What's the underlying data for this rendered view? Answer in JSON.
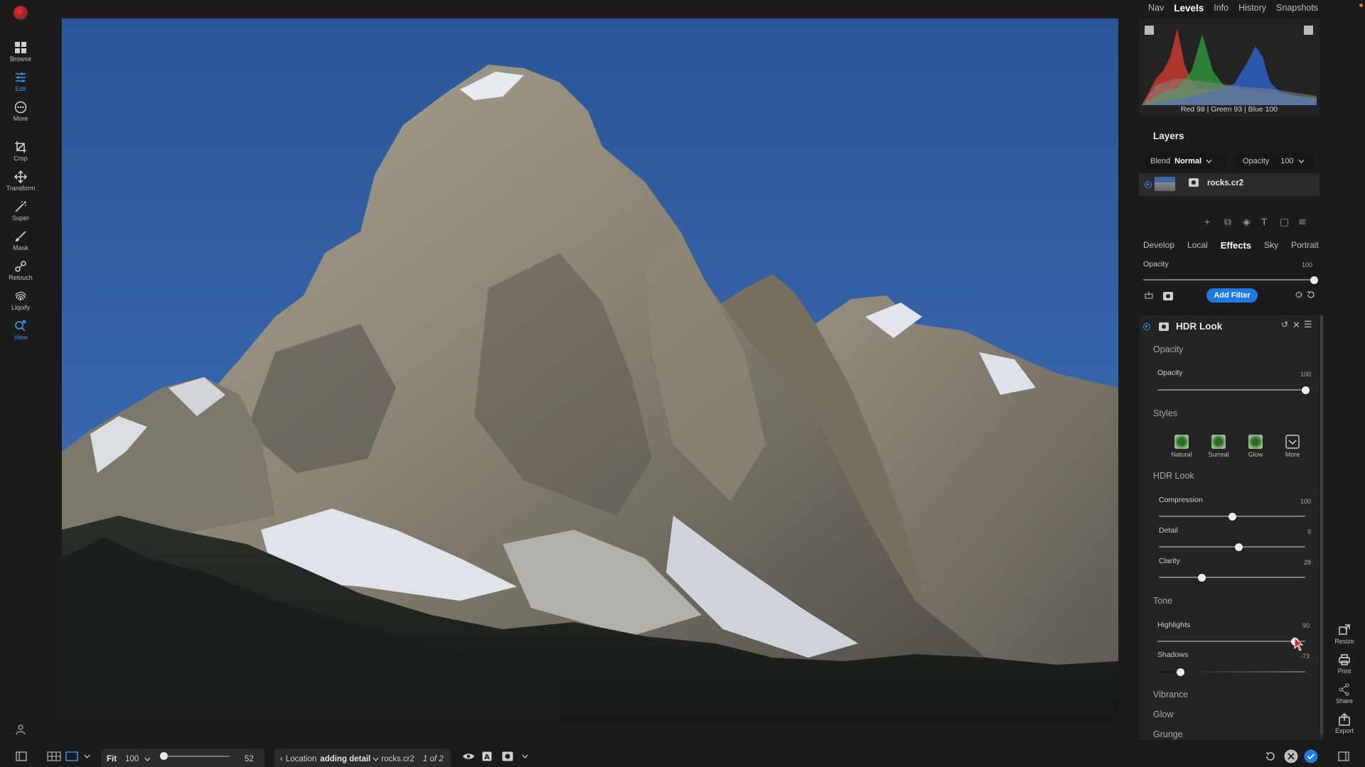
{
  "left_toolbar": {
    "tools": [
      {
        "label": "Browse",
        "icon": "grid-icon"
      },
      {
        "label": "Edit",
        "icon": "sliders-icon",
        "active": true
      },
      {
        "label": "More",
        "icon": "more-circle-icon"
      },
      {
        "label": "Crop",
        "icon": "crop-icon"
      },
      {
        "label": "Transform",
        "icon": "move-icon"
      },
      {
        "label": "Super",
        "icon": "wand-icon"
      },
      {
        "label": "Mask",
        "icon": "brush-icon"
      },
      {
        "label": "Retouch",
        "icon": "retouch-icon"
      },
      {
        "label": "Liquify",
        "icon": "fingerprint-icon"
      },
      {
        "label": "View",
        "icon": "view-icon"
      }
    ]
  },
  "panel_tabs": [
    "Nav",
    "Levels",
    "Info",
    "History",
    "Snapshots"
  ],
  "panel_tab_active": "Levels",
  "histogram": {
    "readout": {
      "red_label": "Red",
      "red": "98",
      "green_label": "| Green",
      "green": "93",
      "blue_label": "| Blue",
      "blue": "100"
    }
  },
  "layers": {
    "title": "Layers",
    "blend_label": "Blend",
    "blend_value": "Normal",
    "opacity_label": "Opacity",
    "opacity_value": "100",
    "items": [
      {
        "name": "rocks.cr2",
        "visible": true
      }
    ]
  },
  "module_tabs": [
    "Develop",
    "Local",
    "Effects",
    "Sky",
    "Portrait"
  ],
  "module_tab_active": "Effects",
  "effects": {
    "opacity_label": "Opacity",
    "opacity_value": "100",
    "opacity_fraction": 1.0,
    "add_filter_label": "Add Filter"
  },
  "filter": {
    "name": "HDR Look",
    "opacity_group": "Opacity",
    "opacity_label": "Opacity",
    "opacity_value": "100",
    "opacity_fraction": 1.0,
    "styles_group": "Styles",
    "styles": [
      "Natural",
      "Surreal",
      "Glow",
      "More"
    ],
    "hdr_group": "HDR Look",
    "compression_label": "Compression",
    "compression_value": "100",
    "compression_fraction": 0.5,
    "detail_label": "Detail",
    "detail_value": "9",
    "detail_fraction": 0.545,
    "clarity_label": "Clarity",
    "clarity_value": "28",
    "clarity_fraction": 0.29,
    "tone_group": "Tone",
    "highlights_label": "Highlights",
    "highlights_value": "90",
    "highlights_fraction": 0.93,
    "shadows_label": "Shadows",
    "shadows_value": "-73",
    "shadows_fraction": 0.155,
    "collapsed_groups": [
      "Vibrance",
      "Glow",
      "Grunge"
    ]
  },
  "right_strip": [
    "Resize",
    "Print",
    "Share",
    "Export"
  ],
  "bottom_bar": {
    "fit_label": "Fit",
    "zoom_value": "100",
    "zoom_slider_value": "52",
    "zoom_slider_fraction": 0.0,
    "location_label": "Location",
    "location_value": "adding detail",
    "file_name": "rocks.cr2",
    "page_of": "1 of 2"
  },
  "colors": {
    "accent": "#1e7ae0",
    "panel": "#232323",
    "background": "#1b1b1b"
  }
}
